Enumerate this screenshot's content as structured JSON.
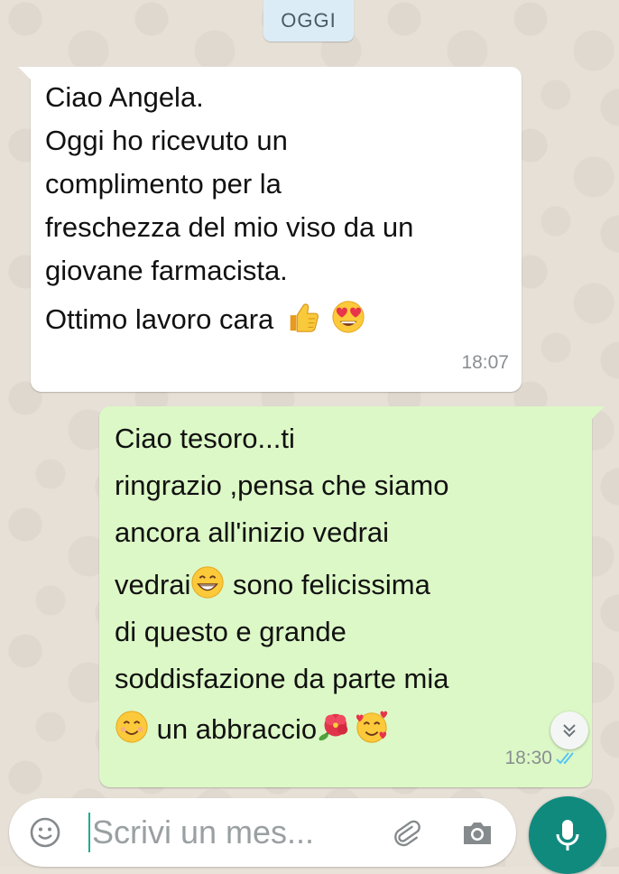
{
  "date_chip": "OGGI",
  "messages": [
    {
      "direction": "incoming",
      "lines": [
        "Ciao Angela.",
        "Oggi ho ricevuto un",
        "complimento per la",
        "freschezza del mio viso da un",
        "giovane farmacista.",
        "Ottimo lavoro cara"
      ],
      "emojis": [
        "thumbs-up",
        "heart-eyes"
      ],
      "time": "18:07"
    },
    {
      "direction": "outgoing",
      "lines": [
        "Ciao tesoro...ti",
        "ringrazio ,pensa che siamo",
        "ancora all'inizio vedrai",
        "vedrai",
        " sono felicissima",
        "di questo e grande",
        "soddisfazione da parte mia",
        " un abbraccio"
      ],
      "emojis": [
        "grinning",
        "smiling",
        "hibiscus",
        "smiling-hearts"
      ],
      "time": "18:30",
      "status": "read"
    }
  ],
  "composer": {
    "placeholder": "Scrivi un mes..."
  },
  "colors": {
    "incoming_bubble": "#ffffff",
    "outgoing_bubble": "#dcf8c6",
    "mic_button": "#118a7e",
    "read_ticks": "#4fc3f7"
  }
}
